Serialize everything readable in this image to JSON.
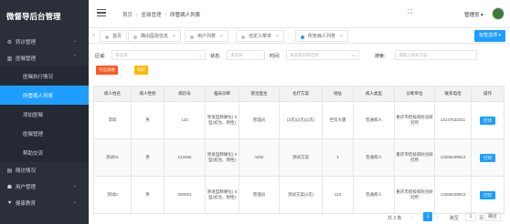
{
  "sidebar": {
    "brand": "微督导后台管理",
    "items": [
      {
        "icon": "gear-icon",
        "label": "转诊管理",
        "expanded": false
      },
      {
        "icon": "chart-icon",
        "label": "医嘱管理",
        "expanded": true
      }
    ],
    "sub_items": [
      {
        "label": "医嘱执行情况",
        "active": false
      },
      {
        "label": "所管病人列表",
        "active": true
      },
      {
        "label": "添加医嘱",
        "active": false
      },
      {
        "label": "医嘱管理",
        "active": false
      },
      {
        "label": "帮助交流",
        "active": false
      }
    ],
    "bottom_items": [
      {
        "icon": "document-icon",
        "label": "随访情况"
      },
      {
        "icon": "user-icon",
        "label": "用户管理"
      },
      {
        "icon": "heart-icon",
        "label": "健康教育"
      }
    ]
  },
  "header": {
    "breadcrumb": [
      "首页",
      "医嘱管理",
      "所管病人列表"
    ],
    "admin_label": "管理员 ▾"
  },
  "tabs": [
    {
      "label": "首页",
      "active": false
    },
    {
      "label": "确出医院信息",
      "active": false
    },
    {
      "label": "用户列表",
      "active": false
    },
    {
      "label": "自定义菜单",
      "active": false
    },
    {
      "label": "所管病人列表",
      "active": true
    }
  ],
  "tab_options_label": "标签选项 ▾",
  "filters": {
    "region_label": "区域:",
    "region_placeholder": "请选择",
    "status_label": "状态:",
    "status_placeholder": "请选择",
    "time_label": "时间:",
    "time_placeholder": "请选择日期范围",
    "search_label": "搜索:",
    "search_placeholder": "请输入搜索内容"
  },
  "actions": {
    "export_label": "导出表格",
    "refresh_label": "刷新"
  },
  "table": {
    "headers": [
      "病人姓名",
      "病人性别",
      "病历号",
      "临床诊断",
      "管治医生",
      "化疗方案",
      "地址",
      "病人类型",
      "诊断单位",
      "联系电话",
      "操作"
    ],
    "rows": [
      [
        "李四",
        "男",
        "123",
        "原发型肺硬化( II 型(初治、阴性)",
        "管理员",
        "(2次)(2次)(2次)",
        "世贸大厦",
        "普通病人",
        "重庆市结核病防治研究所",
        "13147532311",
        "打印"
      ],
      [
        "测试01",
        "男",
        "123456",
        "原发型肺硬化( II 型(初治、阴性)",
        "ni2br",
        "测试方案",
        "1",
        "普通病人",
        "重庆市结核病防治研究所",
        "13288238912",
        "打印"
      ],
      [
        "测试0",
        "男",
        "000001",
        "原发型肺硬化( II 型(初治、阴性)",
        "管理员",
        "测试方案(2次)",
        "123",
        "普通病人",
        "重庆市结核病防治研究所",
        "13288238912",
        "打印"
      ]
    ]
  },
  "pager": {
    "total": "共 3 条",
    "prev": "‹",
    "page": "1",
    "next": "›",
    "goto_label": "跳至",
    "goto_value": "1",
    "page_word": "页",
    "confirm_label": "确定"
  },
  "colors": {
    "sidebar_bg": "#2b2f3a",
    "accent": "#1e9fff",
    "export_btn": "#ff5722",
    "refresh_btn": "#ffb800"
  }
}
